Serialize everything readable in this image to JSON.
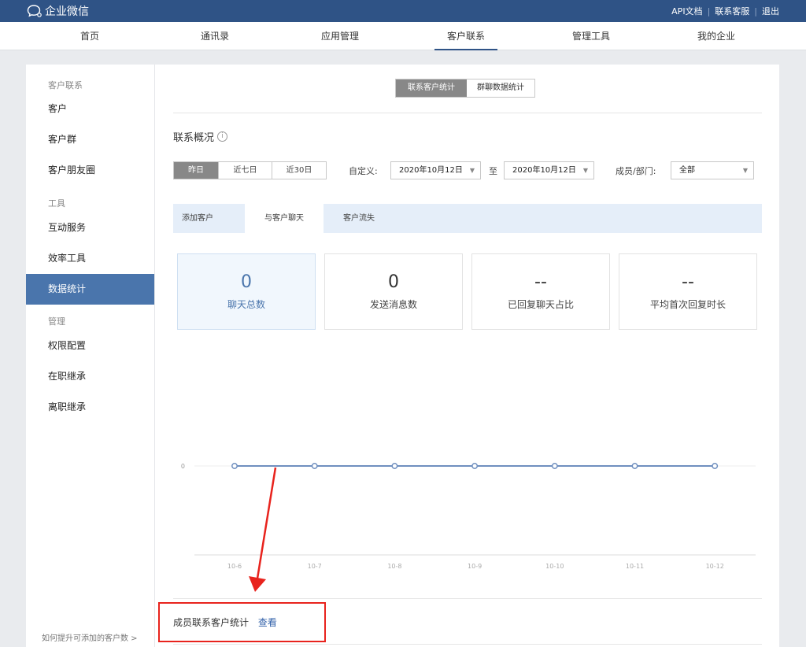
{
  "app": {
    "name": "企业微信",
    "top_links": [
      "API文档",
      "联系客服",
      "退出"
    ]
  },
  "nav": {
    "items": [
      "首页",
      "通讯录",
      "应用管理",
      "客户联系",
      "管理工具",
      "我的企业"
    ],
    "active": "客户联系"
  },
  "sidebar": {
    "groups": [
      {
        "title": "客户联系",
        "items": [
          "客户",
          "客户群",
          "客户朋友圈"
        ]
      },
      {
        "title": "工具",
        "items": [
          "互动服务",
          "效率工具",
          "数据统计"
        ]
      },
      {
        "title": "管理",
        "items": [
          "权限配置",
          "在职继承",
          "离职继承"
        ]
      }
    ],
    "active": "数据统计",
    "footer": "如何提升可添加的客户数 >"
  },
  "main": {
    "segment_tabs": [
      "联系客户统计",
      "群聊数据统计"
    ],
    "segment_active": "联系客户统计",
    "overview_title": "联系概况",
    "info_icon": "ⓘ",
    "range_buttons": [
      "昨日",
      "近七日",
      "近30日"
    ],
    "range_active": "昨日",
    "custom_label": "自定义:",
    "date_from": "2020年10月12日",
    "to_label": "至",
    "date_to": "2020年10月12日",
    "member_label": "成员/部门:",
    "member_value": "全部",
    "sub_tabs": [
      "添加客户",
      "与客户聊天",
      "客户流失"
    ],
    "sub_active": "与客户聊天",
    "cards": [
      {
        "value": "0",
        "label": "聊天总数"
      },
      {
        "value": "0",
        "label": "发送消息数"
      },
      {
        "value": "--",
        "label": "已回复聊天占比"
      },
      {
        "value": "--",
        "label": "平均首次回复时长"
      }
    ],
    "member_stats_label": "成员联系客户统计",
    "member_stats_link": "查看"
  },
  "chart_data": {
    "type": "line",
    "categories": [
      "10-6",
      "10-7",
      "10-8",
      "10-9",
      "10-10",
      "10-11",
      "10-12"
    ],
    "series": [
      {
        "values": [
          0,
          0,
          0,
          0,
          0,
          0,
          0
        ]
      }
    ],
    "y_ticks": [
      "0"
    ],
    "color": "#6f8fbf",
    "grid": true
  },
  "colors": {
    "header": "#2f5386",
    "active_sidebar": "#4a75ac",
    "highlight": "#e8231d",
    "link": "#2f5fa8"
  }
}
